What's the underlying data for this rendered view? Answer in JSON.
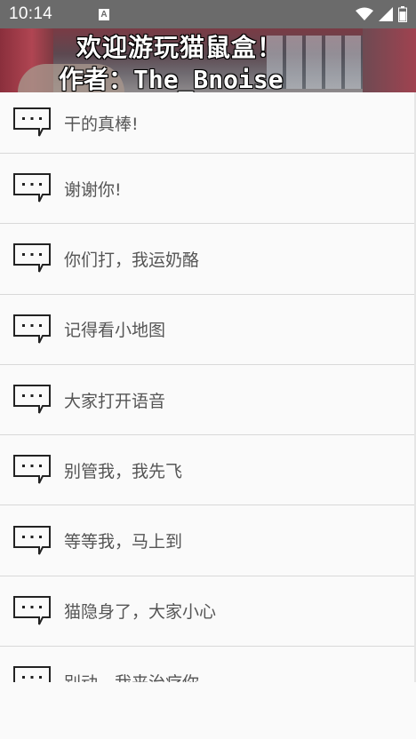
{
  "status_bar": {
    "time": "10:14",
    "notification_icon": "A"
  },
  "banner": {
    "title_line1": "欢迎游玩猫鼠盒！",
    "title_line2": "作者：The_Bnoise"
  },
  "list": {
    "items": [
      {
        "icon": "chat-bubble-icon",
        "label": "干的真棒!"
      },
      {
        "icon": "chat-bubble-icon",
        "label": "谢谢你!"
      },
      {
        "icon": "chat-bubble-icon",
        "label": "你们打，我运奶酪"
      },
      {
        "icon": "chat-bubble-icon",
        "label": "记得看小地图"
      },
      {
        "icon": "chat-bubble-icon",
        "label": "大家打开语音"
      },
      {
        "icon": "chat-bubble-icon",
        "label": "别管我，我先飞"
      },
      {
        "icon": "chat-bubble-icon",
        "label": "等等我，马上到"
      },
      {
        "icon": "chat-bubble-icon",
        "label": "猫隐身了，大家小心"
      },
      {
        "icon": "chat-bubble-icon",
        "label": "别动，我来治疗你"
      }
    ]
  }
}
